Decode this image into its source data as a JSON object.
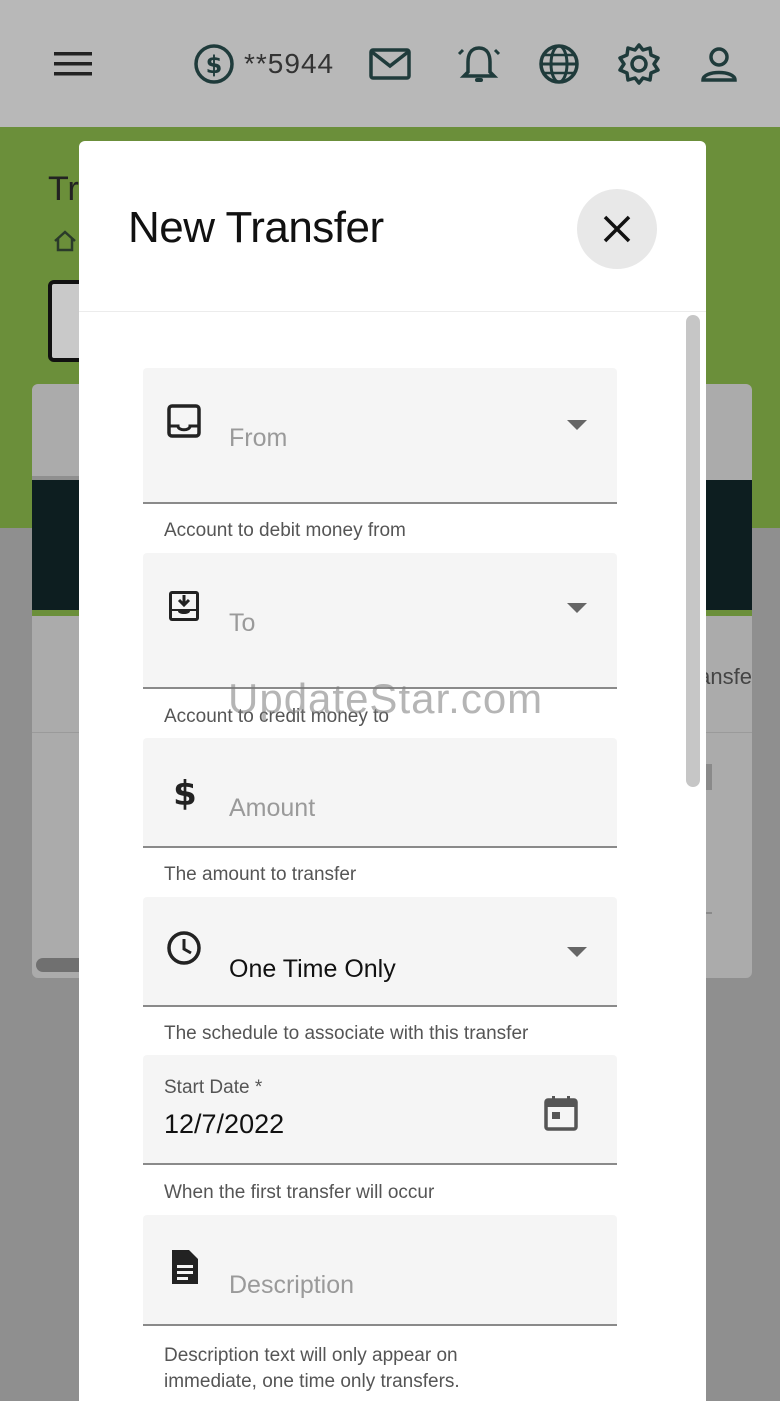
{
  "topbar": {
    "account_number": "**5944"
  },
  "background": {
    "title": "Tr",
    "snippet": "ansfe"
  },
  "modal": {
    "title": "New Transfer",
    "fields": {
      "from": {
        "label": "From",
        "hint": "Account to debit money from"
      },
      "to": {
        "label": "To",
        "hint": "Account to credit money to"
      },
      "amount": {
        "label": "Amount",
        "hint": "The amount to transfer"
      },
      "schedule": {
        "value": "One Time Only",
        "hint": "The schedule to associate with this transfer"
      },
      "start_date": {
        "label": "Start Date *",
        "value": "12/7/2022",
        "hint": "When the first transfer will occur"
      },
      "description": {
        "label": "Description",
        "hint": "Description text will only appear on immediate, one time only transfers."
      }
    }
  },
  "watermark": "UpdateStar.com",
  "colors": {
    "accent_green": "#6b8f3a",
    "dark_stripe": "#0d1e20"
  }
}
